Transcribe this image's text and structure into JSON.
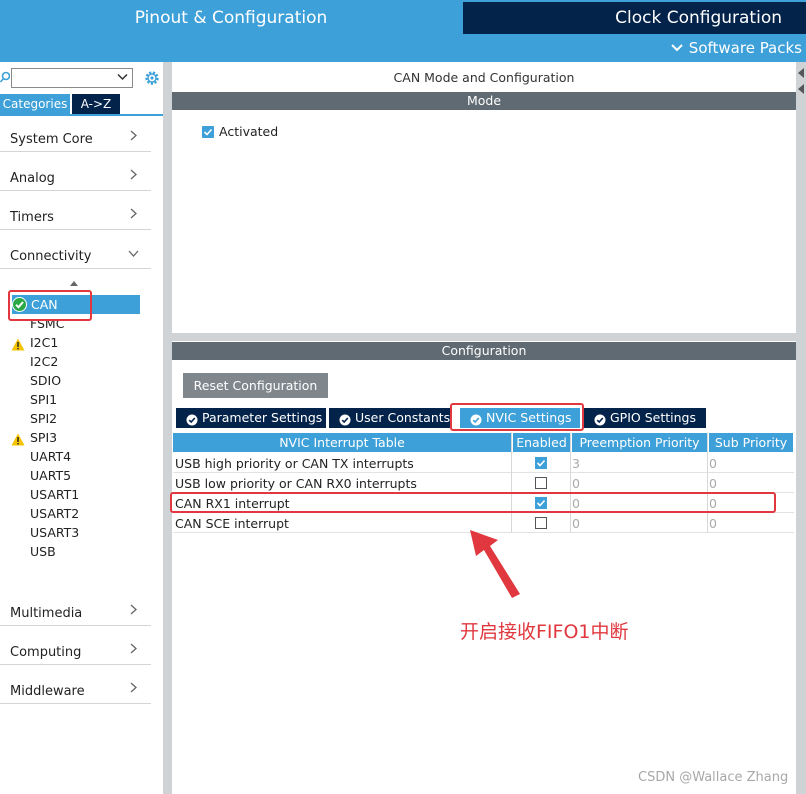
{
  "header": {
    "tab_pinout": "Pinout & Configuration",
    "tab_clock": "Clock Configuration",
    "software_packs": "Software Packs"
  },
  "sidebar": {
    "search_value": "",
    "tab_categories": "Categories",
    "tab_az": "A->Z",
    "sections": [
      {
        "label": "System Core"
      },
      {
        "label": "Analog"
      },
      {
        "label": "Timers"
      },
      {
        "label": "Connectivity"
      },
      {
        "label": "Multimedia"
      },
      {
        "label": "Computing"
      },
      {
        "label": "Middleware"
      }
    ],
    "connectivity_items": [
      {
        "label": "CAN",
        "status": "ok",
        "selected": true
      },
      {
        "label": "FSMC"
      },
      {
        "label": "I2C1",
        "status": "warning"
      },
      {
        "label": "I2C2"
      },
      {
        "label": "SDIO"
      },
      {
        "label": "SPI1"
      },
      {
        "label": "SPI2"
      },
      {
        "label": "SPI3",
        "status": "warning"
      },
      {
        "label": "UART4"
      },
      {
        "label": "UART5"
      },
      {
        "label": "USART1"
      },
      {
        "label": "USART2"
      },
      {
        "label": "USART3"
      },
      {
        "label": "USB"
      }
    ]
  },
  "main": {
    "title": "CAN Mode and Configuration",
    "mode_header": "Mode",
    "activated_label": "Activated",
    "activated_checked": true,
    "config_header": "Configuration",
    "reset_button": "Reset Configuration",
    "tabs": [
      {
        "label": "Parameter Settings"
      },
      {
        "label": "User Constants"
      },
      {
        "label": "NVIC Settings",
        "active": true
      },
      {
        "label": "GPIO Settings"
      }
    ],
    "table": {
      "headers": [
        "NVIC Interrupt Table",
        "Enabled",
        "Preemption Priority",
        "Sub Priority"
      ],
      "rows": [
        {
          "name": "USB high priority or CAN TX interrupts",
          "enabled": true,
          "preemption": "3",
          "sub": "0"
        },
        {
          "name": "USB low priority or CAN RX0 interrupts",
          "enabled": false,
          "preemption": "0",
          "sub": "0"
        },
        {
          "name": "CAN RX1 interrupt",
          "enabled": true,
          "preemption": "0",
          "sub": "0"
        },
        {
          "name": "CAN SCE interrupt",
          "enabled": false,
          "preemption": "0",
          "sub": "0"
        }
      ]
    }
  },
  "annotation": "开启接收FIFO1中断",
  "watermark": "CSDN @Wallace Zhang",
  "colors": {
    "accent": "#3ea0d8",
    "dark": "#03234b",
    "highlight": "#e0383e",
    "bar": "#5f6a72"
  }
}
